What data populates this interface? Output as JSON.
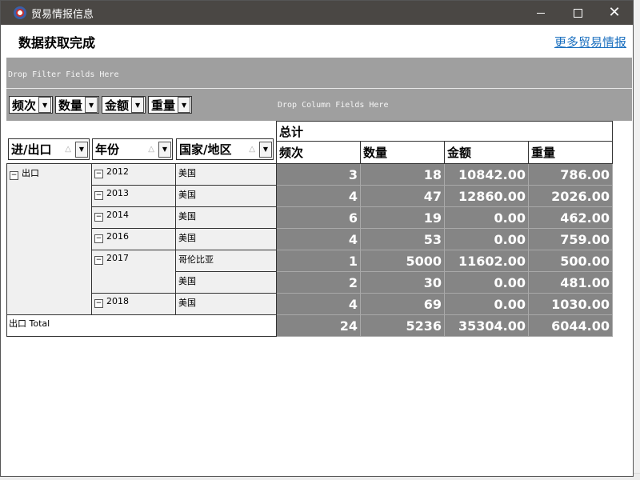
{
  "window": {
    "title": "贸易情报信息"
  },
  "header": {
    "status": "数据获取完成",
    "more_link": "更多贸易情报"
  },
  "pivot": {
    "filter_hint": "Drop Filter Fields Here",
    "column_hint": "Drop Column Fields Here",
    "data_fields": [
      "频次",
      "数量",
      "金额",
      "重量"
    ],
    "row_fields": [
      "进/出口",
      "年份",
      "国家/地区"
    ],
    "grand_column": "总计",
    "columns": [
      "频次",
      "数量",
      "金额",
      "重量"
    ],
    "direction": "出口",
    "years": [
      {
        "year": "2012",
        "rows": [
          {
            "country": "美国",
            "values": [
              "3",
              "18",
              "10842.00",
              "786.00"
            ]
          }
        ]
      },
      {
        "year": "2013",
        "rows": [
          {
            "country": "美国",
            "values": [
              "4",
              "47",
              "12860.00",
              "2026.00"
            ]
          }
        ]
      },
      {
        "year": "2014",
        "rows": [
          {
            "country": "美国",
            "values": [
              "6",
              "19",
              "0.00",
              "462.00"
            ]
          }
        ]
      },
      {
        "year": "2016",
        "rows": [
          {
            "country": "美国",
            "values": [
              "4",
              "53",
              "0.00",
              "759.00"
            ]
          }
        ]
      },
      {
        "year": "2017",
        "rows": [
          {
            "country": "哥伦比亚",
            "values": [
              "1",
              "5000",
              "11602.00",
              "500.00"
            ]
          },
          {
            "country": "美国",
            "values": [
              "2",
              "30",
              "0.00",
              "481.00"
            ]
          }
        ]
      },
      {
        "year": "2018",
        "rows": [
          {
            "country": "美国",
            "values": [
              "4",
              "69",
              "0.00",
              "1030.00"
            ]
          }
        ]
      }
    ],
    "total_label": "出口 Total",
    "total_values": [
      "24",
      "5236",
      "35304.00",
      "6044.00"
    ]
  }
}
